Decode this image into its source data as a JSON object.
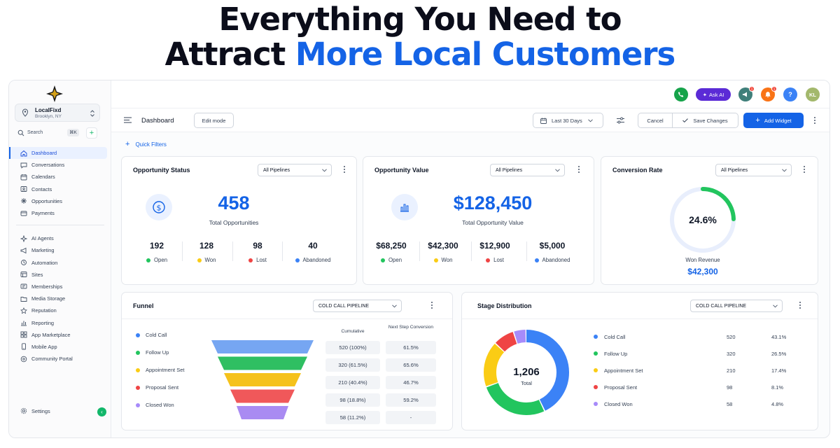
{
  "hero": {
    "line1": "Everything You Need to",
    "line2_prefix": "Attract ",
    "line2_accent": "More Local Customers"
  },
  "colors": {
    "accent": "#1463e6",
    "green": "#22c55e",
    "yellow": "#facc15",
    "red": "#ef4444",
    "blue": "#3b82f6",
    "purple": "#a78bfa"
  },
  "sidebar": {
    "location_name": "LocalFixd",
    "location_sub": "Brooklyn, NY",
    "search_label": "Search",
    "search_shortcut": "⌘K",
    "nav_group1": [
      {
        "label": "Dashboard",
        "icon": "home-icon",
        "active": true
      },
      {
        "label": "Conversations",
        "icon": "chat-icon"
      },
      {
        "label": "Calendars",
        "icon": "calendar-icon"
      },
      {
        "label": "Contacts",
        "icon": "contacts-icon"
      },
      {
        "label": "Opportunities",
        "icon": "opportunities-icon"
      },
      {
        "label": "Payments",
        "icon": "payments-icon"
      }
    ],
    "nav_group2": [
      {
        "label": "AI Agents",
        "icon": "ai-sparkle-icon"
      },
      {
        "label": "Marketing",
        "icon": "megaphone-icon"
      },
      {
        "label": "Automation",
        "icon": "automation-icon"
      },
      {
        "label": "Sites",
        "icon": "sites-icon"
      },
      {
        "label": "Memberships",
        "icon": "memberships-icon"
      },
      {
        "label": "Media Storage",
        "icon": "folder-icon"
      },
      {
        "label": "Reputation",
        "icon": "star-icon"
      },
      {
        "label": "Reporting",
        "icon": "chart-icon"
      },
      {
        "label": "App Marketplace",
        "icon": "grid-icon"
      },
      {
        "label": "Mobile App",
        "icon": "phone-icon"
      },
      {
        "label": "Community Portal",
        "icon": "globe-icon"
      }
    ],
    "settings_label": "Settings"
  },
  "topbar": {
    "ask_ai_label": "Ask AI",
    "announce_badge": "1",
    "notif_badge": "1",
    "help": "?",
    "avatar": "KL"
  },
  "toolbar": {
    "title": "Dashboard",
    "edit_mode": "Edit mode",
    "date_range": "Last 30 Days",
    "cancel": "Cancel",
    "save": "Save Changes",
    "add_widget": "Add Widget",
    "quick_filters": "Quick Filters"
  },
  "opportunity_status": {
    "title": "Opportunity Status",
    "pipeline": "All Pipelines",
    "total": "458",
    "total_label": "Total Opportunities",
    "stats": [
      {
        "value": "192",
        "label": "Open",
        "color": "#22c55e"
      },
      {
        "value": "128",
        "label": "Won",
        "color": "#facc15"
      },
      {
        "value": "98",
        "label": "Lost",
        "color": "#ef4444"
      },
      {
        "value": "40",
        "label": "Abandoned",
        "color": "#3b82f6"
      }
    ]
  },
  "opportunity_value": {
    "title": "Opportunity Value",
    "pipeline": "All Pipelines",
    "total": "$128,450",
    "total_label": "Total Opportunity Value",
    "stats": [
      {
        "value": "$68,250",
        "label": "Open",
        "color": "#22c55e"
      },
      {
        "value": "$42,300",
        "label": "Won",
        "color": "#facc15"
      },
      {
        "value": "$12,900",
        "label": "Lost",
        "color": "#ef4444"
      },
      {
        "value": "$5,000",
        "label": "Abandoned",
        "color": "#3b82f6"
      }
    ]
  },
  "conversion_rate": {
    "title": "Conversion Rate",
    "pipeline": "All Pipelines",
    "rate_label": "24.6%",
    "rate": 24.6,
    "won_label": "Won Revenue",
    "won_value": "$42,300"
  },
  "funnel": {
    "title": "Funnel",
    "pipeline": "COLD CALL PIPELINE",
    "col_cumulative": "Cumulative",
    "col_next": "Next Step Conversion",
    "stages": [
      {
        "label": "Cold Call",
        "color": "#3b82f6",
        "bar": "#76a6f2",
        "cumulative": "520 (100%)",
        "next": "61.5%"
      },
      {
        "label": "Follow Up",
        "color": "#22c55e",
        "bar": "#2fbf62",
        "cumulative": "320 (61.5%)",
        "next": "65.6%"
      },
      {
        "label": "Appointment Set",
        "color": "#facc15",
        "bar": "#f5c21b",
        "cumulative": "210 (40.4%)",
        "next": "46.7%"
      },
      {
        "label": "Proposal Sent",
        "color": "#ef4444",
        "bar": "#f0585a",
        "cumulative": "98 (18.8%)",
        "next": "59.2%"
      },
      {
        "label": "Closed Won",
        "color": "#a78bfa",
        "bar": "#a98bf2",
        "cumulative": "58 (11.2%)",
        "next": "-"
      }
    ]
  },
  "stage_distribution": {
    "title": "Stage Distribution",
    "pipeline": "COLD CALL PIPELINE",
    "total": "1,206",
    "total_label": "Total",
    "rows": [
      {
        "label": "Cold Call",
        "count": "520",
        "pct": "43.1%",
        "value": 43.1,
        "color": "#3b82f6"
      },
      {
        "label": "Follow Up",
        "count": "320",
        "pct": "26.5%",
        "value": 26.5,
        "color": "#22c55e"
      },
      {
        "label": "Appointment Set",
        "count": "210",
        "pct": "17.4%",
        "value": 17.4,
        "color": "#facc15"
      },
      {
        "label": "Proposal Sent",
        "count": "98",
        "pct": "8.1%",
        "value": 8.1,
        "color": "#ef4444"
      },
      {
        "label": "Closed Won",
        "count": "58",
        "pct": "4.8%",
        "value": 4.8,
        "color": "#a78bfa"
      }
    ]
  }
}
